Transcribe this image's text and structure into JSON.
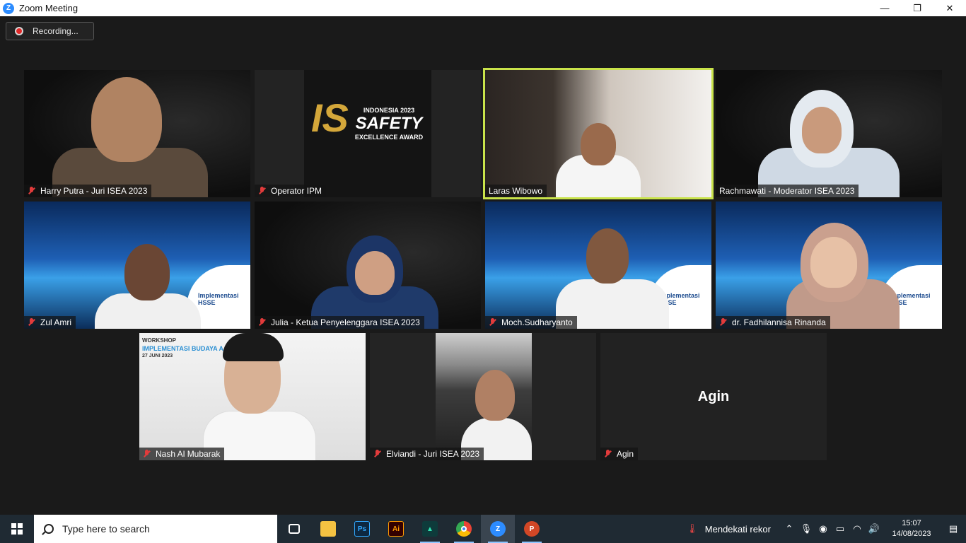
{
  "window": {
    "title": "Zoom Meeting",
    "minimize": "—",
    "maximize": "❐",
    "close": "✕"
  },
  "recording": {
    "label": "Recording..."
  },
  "tiles": [
    {
      "name": "Harry Putra - Juri ISEA 2023"
    },
    {
      "name": "Operator IPM",
      "brand_top": "INDONESIA 2023",
      "brand_main": "SAFETY",
      "brand_sub": "EXCELLENCE AWARD"
    },
    {
      "name": "Laras Wibowo"
    },
    {
      "name": "Rachmawati - Moderator ISEA 2023"
    },
    {
      "name": "Zul Amri",
      "overlay": "Implementasi HSSE"
    },
    {
      "name": "Julia - Ketua Penyelenggara ISEA 2023"
    },
    {
      "name": "Moch.Sudharyanto",
      "overlay": "Implementasi HSSE"
    },
    {
      "name": "dr. Fadhilannisa Rinanda",
      "overlay": "Implementasi HSSE"
    },
    {
      "name": "Nash Al Mubarak",
      "overlay_l1": "WORKSHOP",
      "overlay_l2": "IMPLEMENTASI BUDAYA A",
      "overlay_l3": "27 JUNI 2023"
    },
    {
      "name": "Elviandi - Juri ISEA 2023"
    },
    {
      "name": "Agin",
      "center_name": "Agin"
    }
  ],
  "taskbar": {
    "search_placeholder": "Type here to search",
    "weather": "Mendekati rekor",
    "time": "15:07",
    "date": "14/08/2023",
    "apps": [
      "task-view",
      "file-explorer",
      "photoshop",
      "illustrator",
      "app-green",
      "chrome",
      "zoom",
      "powerpoint"
    ]
  },
  "colors": {
    "active_speaker": "#c9e34a",
    "muted": "#e23b3b",
    "zoom_blue": "#2d8cff"
  }
}
